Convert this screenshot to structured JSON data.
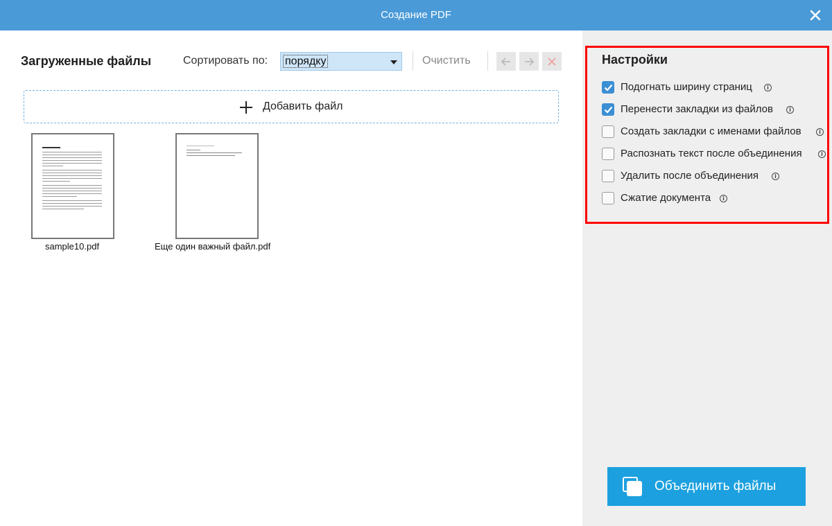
{
  "window": {
    "title": "Создание PDF",
    "close_icon": "close-icon"
  },
  "files_panel": {
    "heading": "Загруженные файлы",
    "sort_label": "Сортировать по:",
    "sort_value": "порядку",
    "clear_label": "Очистить",
    "nav_icons": [
      "arrow-left-icon",
      "arrow-right-icon",
      "delete-icon"
    ],
    "add_file_label": "Добавить файл",
    "files": [
      {
        "name": "sample10.pdf"
      },
      {
        "name": "Еще один важный файл.pdf"
      }
    ]
  },
  "settings": {
    "title": "Настройки",
    "options": [
      {
        "label": "Подогнать ширину страниц",
        "checked": true
      },
      {
        "label": "Перенести закладки из файлов",
        "checked": true
      },
      {
        "label": "Создать закладки с именами файлов",
        "checked": false
      },
      {
        "label": "Распознать текст после объединения",
        "checked": false
      },
      {
        "label": "Удалить после объединения",
        "checked": false
      },
      {
        "label": "Сжатие документа",
        "checked": false
      }
    ],
    "info_glyph": "i",
    "merge_button_label": "Объединить файлы"
  },
  "colors": {
    "titlebar": "#4a9ad8",
    "accent": "#1ca0df",
    "checkbox_checked": "#3b8fd4",
    "highlight_box": "#ff0000"
  }
}
